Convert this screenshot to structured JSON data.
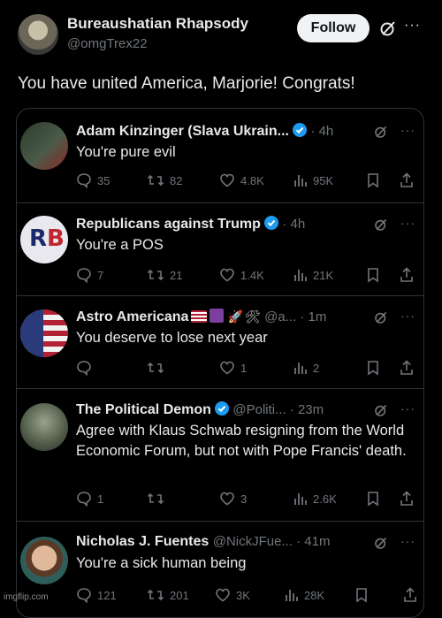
{
  "header": {
    "display_name": "Bureaushatian Rhapsody",
    "handle": "@omgTrex22",
    "follow_label": "Follow",
    "more_label": "···"
  },
  "post": {
    "text": "You have united America, Marjorie! Congrats!"
  },
  "replies": [
    {
      "name": "Adam Kinzinger (Slava Ukrain...",
      "verified": true,
      "meta": "· 4h",
      "text": "You're pure evil",
      "stats": {
        "replies": "35",
        "reposts": "82",
        "likes": "4.8K",
        "views": "95K"
      }
    },
    {
      "name": "Republicans against Trump",
      "verified": true,
      "meta": "· 4h",
      "text": "You're a POS",
      "stats": {
        "replies": "7",
        "reposts": "21",
        "likes": "1.4K",
        "views": "21K"
      }
    },
    {
      "name": "Astro Americana",
      "verified": false,
      "meta": "@a... · 1m",
      "text": "You deserve to lose next year",
      "stats": {
        "replies": "",
        "reposts": "",
        "likes": "1",
        "views": "2"
      }
    },
    {
      "name": "The Political Demon",
      "verified": true,
      "meta": "@Politi... · 23m",
      "text": "Agree with Klaus Schwab resigning from the World Economic Forum, but not with Pope Francis' death.",
      "stats": {
        "replies": "1",
        "reposts": "",
        "likes": "3",
        "views": "2.6K"
      }
    },
    {
      "name": "Nicholas J. Fuentes",
      "verified": false,
      "meta": "@NickJFue... · 41m",
      "text": "You're a sick human being",
      "stats": {
        "replies": "121",
        "reposts": "201",
        "likes": "3K",
        "views": "28K"
      }
    }
  ],
  "watermark": "imgflip.com",
  "colors": {
    "background": "#000000",
    "text": "#e7e9ea",
    "muted": "#71767b",
    "verified": "#1d9bf0",
    "border": "#2f3336"
  }
}
